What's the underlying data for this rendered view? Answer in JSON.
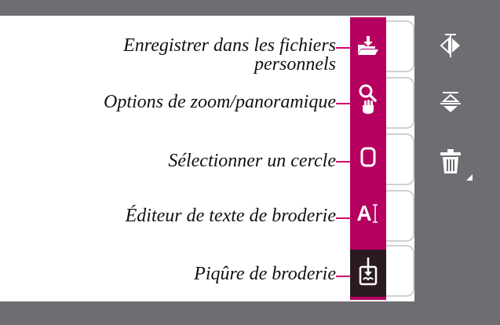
{
  "callouts": [
    {
      "line1": "Enregistrer dans les fichiers",
      "line2": "personnels"
    },
    {
      "line1": "Options de zoom/panoramique"
    },
    {
      "line1": "Sélectionner un cercle"
    },
    {
      "line1": "Éditeur de texte de broderie"
    },
    {
      "line1": "Piqûre de broderie"
    }
  ],
  "toolbar_icons": [
    "folder-save-icon",
    "zoom-pan-icon",
    "circle-select-icon",
    "text-editor-icon",
    "stitchout-icon"
  ],
  "side_icons": [
    "mirror-horizontal-icon",
    "mirror-vertical-icon",
    "delete-icon"
  ],
  "colors": {
    "accent": "#b5005f",
    "leader": "#d4006e",
    "panel": "#6d6e71",
    "dark_button": "#2b1a22"
  }
}
